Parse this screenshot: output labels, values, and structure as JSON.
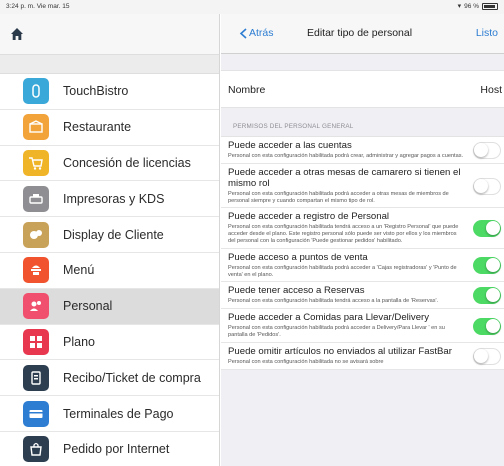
{
  "status_bar": {
    "time": "3:24 p. m.  Vie mar. 15",
    "battery": "96 %"
  },
  "sidebar": {
    "home_icon": "home-icon",
    "items": [
      {
        "label": "TouchBistro",
        "icon": "touchbistro-icon",
        "color": "#3aa8d8",
        "selected": false
      },
      {
        "label": "Restaurante",
        "icon": "restaurant-icon",
        "color": "#f2a43a",
        "selected": false
      },
      {
        "label": "Concesión de licencias",
        "icon": "cart-icon",
        "color": "#f0b428",
        "selected": false
      },
      {
        "label": "Impresoras y KDS",
        "icon": "printer-icon",
        "color": "#8e8e93",
        "selected": false
      },
      {
        "label": "Display de Cliente",
        "icon": "customer-display-icon",
        "color": "#c9a25a",
        "selected": false
      },
      {
        "label": "Menú",
        "icon": "menu-icon",
        "color": "#f0532d",
        "selected": false
      },
      {
        "label": "Personal",
        "icon": "staff-icon",
        "color": "#f0506e",
        "selected": true
      },
      {
        "label": "Plano",
        "icon": "floor-plan-icon",
        "color": "#e8384f",
        "selected": false
      },
      {
        "label": "Recibo/Ticket de compra",
        "icon": "receipt-icon",
        "color": "#2c3e50",
        "selected": false
      },
      {
        "label": "Terminales de Pago",
        "icon": "payment-terminal-icon",
        "color": "#2d7dd2",
        "selected": false
      },
      {
        "label": "Pedido por Internet",
        "icon": "online-order-icon",
        "color": "#2c3e50",
        "selected": false
      }
    ]
  },
  "navbar": {
    "back_label": "Atrás",
    "title": "Editar tipo de personal",
    "done_label": "Listo"
  },
  "name_row": {
    "label": "Nombre",
    "value": "Host"
  },
  "section_header": "PERMISOS DEL PERSONAL GENERAL",
  "permissions": [
    {
      "title": "Puede acceder a las cuentas",
      "desc": "Personal con esta configuración habilitada podrá crear, administrar y agregar pagos a cuentas.",
      "enabled": false
    },
    {
      "title": "Puede acceder a otras mesas de camarero si tienen el mismo rol",
      "desc": "Personal con esta configuración habilitada podrá acceder a otras mesas de miembros de personal siempre y cuando compartan el mismo tipo de rol.",
      "enabled": false
    },
    {
      "title": "Puede acceder a registro de Personal",
      "desc": "Personal con esta configuración habilitada tendrá acceso a un 'Registro Personal' que puede acceder desde el plano. Este registro personal sólo puede ser visto por ellos y los miembros del personal con la configuración 'Puede gestionar pedidos' habilitado.",
      "enabled": true
    },
    {
      "title": "Puede acceso a puntos de venta",
      "desc": "Personal con esta configuración habilitada podrá acceder a 'Cajas registradoras' y 'Punto de venta' en el plano.",
      "enabled": true
    },
    {
      "title": "Puede tener acceso a Reservas",
      "desc": "Personal con esta configuración habilitada tendrá acceso a la pantalla de 'Reservas'.",
      "enabled": true
    },
    {
      "title": "Puede acceder a Comidas para Llevar/Delivery",
      "desc": "Personal con esta configuración habilitada podrá acceder a Delivery/Para Llevar ' en su pantalla de 'Pedidos'.",
      "enabled": true
    },
    {
      "title": "Puede omitir artículos no enviados al utilizar FastBar",
      "desc": "Personal con esta configuración habilitada no se avisará sobre",
      "enabled": false
    }
  ],
  "colors": {
    "accent_blue": "#2d7dd2",
    "toggle_on": "#4cd964",
    "selected_row": "#dcdcdc"
  }
}
